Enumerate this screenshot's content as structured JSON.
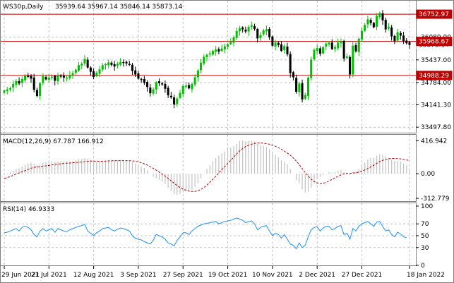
{
  "header": {
    "symbol": "WS30p,Daily",
    "ohlc": "35939.64 35967.14 35846.14 35873.14"
  },
  "price_tags": {
    "upper": "36752.97",
    "middle": "35968.67",
    "current": "35873.14",
    "lower": "34988.29"
  },
  "indicators": {
    "macd": {
      "label": "MACD(12,26,9) 67.787 166.912"
    },
    "rsi": {
      "label": "RSI(14) 46.9333"
    }
  },
  "colors": {
    "bull": "#00c000",
    "bear": "#000000",
    "level_line": "#c00000",
    "macd_hist": "#c0c0c0",
    "macd_signal": "#c00000",
    "rsi_line": "#1e90ff",
    "grid": "#c0c0c0"
  },
  "chart_data": [
    {
      "type": "candlestick",
      "title": "WS30p,Daily",
      "x_ticks": [
        "29 Jun 2021",
        "21 Jul 2021",
        "12 Aug 2021",
        "3 Sep 2021",
        "27 Sep 2021",
        "19 Oct 2021",
        "10 Nov 2021",
        "2 Dec 2021",
        "27 Dec 2021",
        "18 Jan 2022"
      ],
      "y_ticks": [
        36752.97,
        36089.0,
        35437.0,
        34784.0,
        34141.3,
        33497.8
      ],
      "y_tick_labels": [
        "36752.97",
        "36089.00",
        "35437.00",
        "34784.00",
        "34141.30",
        "33497.80"
      ],
      "ylim": [
        33380,
        37080
      ],
      "horizontal_levels": [
        36752.97,
        35968.67,
        34988.29
      ],
      "close": [
        34550,
        34580,
        34620,
        34740,
        34820,
        34760,
        34880,
        34980,
        34960,
        34900,
        34580,
        34400,
        34760,
        34960,
        34880,
        34920,
        34950,
        34840,
        34980,
        34960,
        34930,
        34920,
        35000,
        35050,
        35150,
        35280,
        35320,
        35460,
        35220,
        35100,
        34950,
        35060,
        35160,
        35280,
        35310,
        35360,
        35300,
        35250,
        35320,
        35370,
        35360,
        35340,
        35300,
        35120,
        35020,
        34900,
        34880,
        34780,
        34660,
        34480,
        34580,
        34790,
        34770,
        34740,
        34610,
        34420,
        34360,
        34160,
        34320,
        34480,
        34680,
        34690,
        34620,
        34740,
        34930,
        35120,
        35350,
        35520,
        35580,
        35620,
        35690,
        35730,
        35680,
        35760,
        35820,
        35880,
        35960,
        36080,
        36260,
        36340,
        36320,
        36260,
        36380,
        36430,
        36330,
        36060,
        36150,
        36280,
        36320,
        36090,
        35850,
        35930,
        35870,
        35700,
        35830,
        35600,
        35060,
        34940,
        34520,
        34750,
        34300,
        34420,
        34920,
        35440,
        35720,
        35770,
        35620,
        35800,
        35900,
        35930,
        35750,
        35800,
        35930,
        35970,
        35480,
        35530,
        35020,
        35840,
        35690,
        36040,
        36270,
        36440,
        36600,
        36500,
        36380,
        36700,
        36780,
        36580,
        36320,
        36380,
        36120,
        35980,
        36230,
        36140,
        35980,
        35920,
        35873.14
      ]
    },
    {
      "type": "bar",
      "title": "MACD(12,26,9) 67.787 166.912",
      "y_ticks": [
        416.942,
        0.0,
        -312.779
      ],
      "y_tick_labels": [
        "416.942",
        "0.00",
        "-312.779"
      ],
      "ylim": [
        -330,
        440
      ],
      "series": [
        {
          "name": "MACD",
          "values": [
            -10,
            5,
            18,
            40,
            60,
            70,
            90,
            110,
            130,
            140,
            125,
            110,
            120,
            140,
            150,
            155,
            160,
            150,
            155,
            160,
            160,
            158,
            155,
            160,
            170,
            180,
            190,
            200,
            190,
            175,
            160,
            150,
            152,
            160,
            168,
            172,
            172,
            170,
            170,
            172,
            170,
            166,
            162,
            150,
            130,
            110,
            90,
            70,
            40,
            0,
            -40,
            -60,
            -80,
            -100,
            -130,
            -180,
            -220,
            -260,
            -270,
            -260,
            -240,
            -220,
            -215,
            -200,
            -170,
            -120,
            -60,
            0,
            60,
            110,
            160,
            200,
            230,
            260,
            280,
            300,
            330,
            350,
            380,
            410,
            420,
            410,
            415,
            420,
            410,
            380,
            360,
            350,
            340,
            310,
            270,
            240,
            210,
            170,
            150,
            120,
            60,
            0,
            -80,
            -120,
            -200,
            -240,
            -230,
            -180,
            -120,
            -60,
            -40,
            -20,
            0,
            20,
            10,
            20,
            40,
            50,
            20,
            10,
            -20,
            20,
            30,
            60,
            100,
            140,
            180,
            200,
            200,
            230,
            250,
            240,
            220,
            200,
            180,
            160,
            160,
            150,
            130,
            110,
            67.787
          ]
        },
        {
          "name": "Signal",
          "values": [
            -60,
            -50,
            -35,
            -20,
            -5,
            10,
            25,
            40,
            55,
            70,
            80,
            85,
            90,
            95,
            100,
            105,
            112,
            118,
            122,
            126,
            130,
            133,
            136,
            140,
            142,
            145,
            148,
            153,
            157,
            160,
            160,
            159,
            158,
            158,
            160,
            162,
            164,
            165,
            166,
            166,
            166,
            166,
            165,
            163,
            158,
            150,
            140,
            126,
            110,
            90,
            68,
            45,
            20,
            -5,
            -30,
            -60,
            -90,
            -120,
            -150,
            -175,
            -195,
            -210,
            -220,
            -225,
            -225,
            -215,
            -200,
            -175,
            -145,
            -110,
            -70,
            -30,
            10,
            50,
            90,
            130,
            170,
            210,
            250,
            290,
            320,
            345,
            362,
            375,
            384,
            390,
            390,
            387,
            382,
            374,
            362,
            348,
            330,
            310,
            288,
            263,
            234,
            200,
            160,
            115,
            65,
            15,
            -30,
            -70,
            -100,
            -118,
            -125,
            -122,
            -110,
            -92,
            -72,
            -52,
            -32,
            -15,
            -2,
            5,
            5,
            8,
            12,
            20,
            32,
            48,
            66,
            86,
            108,
            132,
            154,
            170,
            182,
            190,
            194,
            194,
            192,
            188,
            182,
            175,
            166.912
          ]
        }
      ]
    },
    {
      "type": "line",
      "title": "RSI(14) 46.9333",
      "y_ticks": [
        100,
        70,
        50,
        30,
        0
      ],
      "y_tick_labels": [
        "100",
        "70",
        "50",
        "30",
        "0"
      ],
      "ylim": [
        0,
        100
      ],
      "series": [
        {
          "name": "RSI(14)",
          "values": [
            55,
            56,
            58,
            60,
            62,
            58,
            64,
            66,
            64,
            60,
            52,
            48,
            58,
            62,
            58,
            60,
            62,
            56,
            62,
            60,
            58,
            57,
            60,
            62,
            64,
            66,
            67,
            69,
            58,
            54,
            50,
            55,
            58,
            62,
            63,
            64,
            60,
            58,
            61,
            63,
            62,
            60,
            58,
            50,
            46,
            44,
            43,
            40,
            38,
            36,
            42,
            52,
            50,
            48,
            44,
            38,
            36,
            33,
            42,
            48,
            55,
            55,
            52,
            58,
            62,
            66,
            68,
            70,
            71,
            72,
            73,
            74,
            70,
            72,
            74,
            75,
            76,
            78,
            80,
            78,
            76,
            72,
            74,
            75,
            70,
            60,
            64,
            66,
            67,
            58,
            50,
            54,
            52,
            46,
            52,
            44,
            36,
            34,
            28,
            38,
            30,
            34,
            48,
            60,
            64,
            65,
            58,
            63,
            66,
            66,
            60,
            62,
            66,
            67,
            52,
            54,
            44,
            62,
            58,
            66,
            70,
            72,
            74,
            70,
            66,
            73,
            74,
            66,
            58,
            60,
            52,
            48,
            56,
            53,
            48,
            46.9333
          ]
        }
      ]
    }
  ]
}
